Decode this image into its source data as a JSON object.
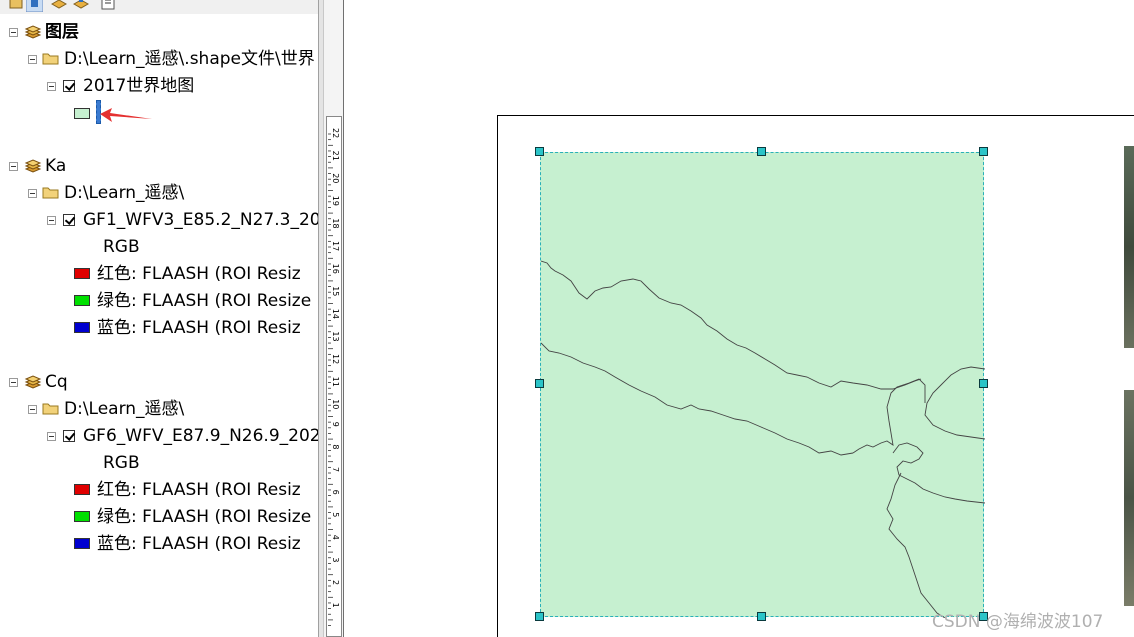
{
  "toc": {
    "groups": [
      {
        "name": "图层",
        "folder": "D:\\Learn_遥感\\.shape文件\\世界",
        "layer": "2017世界地图"
      },
      {
        "name": "Ka",
        "folder": "D:\\Learn_遥感\\",
        "layer": "GF1_WFV3_E85.2_N27.3_20",
        "rgb_label": "RGB",
        "bands": [
          {
            "label": "红色:    FLAASH (ROI Resiz",
            "color": "#e00000"
          },
          {
            "label": "绿色: FLAASH (ROI Resize",
            "color": "#00e000"
          },
          {
            "label": "蓝色:    FLAASH (ROI Resiz",
            "color": "#0000d0"
          }
        ]
      },
      {
        "name": "Cq",
        "folder": "D:\\Learn_遥感\\",
        "layer": "GF6_WFV_E87.9_N26.9_202",
        "rgb_label": "RGB",
        "bands": [
          {
            "label": "红色:    FLAASH (ROI Resiz",
            "color": "#e00000"
          },
          {
            "label": "绿色: FLAASH (ROI Resize",
            "color": "#00e000"
          },
          {
            "label": "蓝色:    FLAASH (ROI Resiz",
            "color": "#0000d0"
          }
        ]
      }
    ],
    "polygon_swatch_color": "#c6f0d0"
  },
  "ruler": {
    "labels": [
      "22",
      "21",
      "20",
      "19",
      "18",
      "17",
      "16",
      "15",
      "14",
      "13",
      "12",
      "11",
      "10",
      "9",
      "8",
      "7",
      "6",
      "5",
      "4",
      "3",
      "2",
      "1"
    ]
  },
  "layout": {
    "map_fill": "#c6f0d0",
    "selection_color": "#2ab0b8"
  },
  "watermark": "CSDN @海绵波波107"
}
